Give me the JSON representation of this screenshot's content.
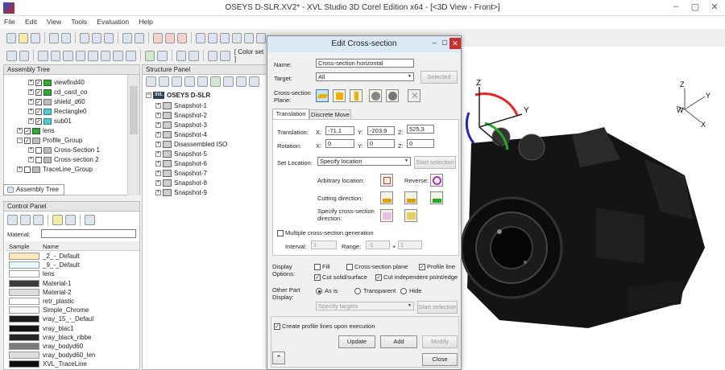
{
  "window": {
    "title": "OSEYS D-SLR.XV2* - XVL Studio 3D Corel Edition x64 - [<3D View - Front>]"
  },
  "menu": [
    "File",
    "Edit",
    "View",
    "Tools",
    "Evaluation",
    "Help"
  ],
  "toolbar2": {
    "color_set": "[ Color set ]"
  },
  "assembly_tree": {
    "header": "Assembly Tree",
    "tab": "Assembly Tree",
    "items": [
      {
        "label": "viewfind40",
        "checked": true
      },
      {
        "label": "cd_card_co",
        "checked": true
      },
      {
        "label": "shield_d60",
        "checked": true
      },
      {
        "label": "Rectangle0",
        "checked": true
      },
      {
        "label": "sub01",
        "checked": true
      },
      {
        "label": "lens",
        "checked": true
      },
      {
        "label": "Profile_Group",
        "checked": true
      },
      {
        "label": "Cross-Section 1",
        "checked": false
      },
      {
        "label": "Cross-section 2",
        "checked": false
      },
      {
        "label": "TraceLine_Group",
        "checked": false
      }
    ]
  },
  "structure_panel": {
    "header": "Structure Panel",
    "root": "OSEYS D-SLR",
    "root_icon": "XVL",
    "items": [
      "Snapshot-1",
      "Snapshot-2",
      "Snapshot-3",
      "Snapshot-4",
      "Disassembled ISO",
      "Snapshot-5",
      "Snapshot-6",
      "Snapshot-7",
      "Snapshot-8",
      "Snapshot-9"
    ]
  },
  "control_panel": {
    "header": "Control Panel",
    "material_label": "Material:",
    "col_sample": "Sample",
    "col_name": "Name",
    "materials": [
      {
        "name": "_2_-_Default",
        "color": "#fbe8b8"
      },
      {
        "name": "_9_-_Default",
        "color": "#e3f6f8"
      },
      {
        "name": "lens",
        "color": "#ffffff"
      },
      {
        "name": "Material-1",
        "color": "#3a3a3a"
      },
      {
        "name": "Material-2",
        "color": "#dcdcdc"
      },
      {
        "name": "retr_plastic",
        "color": "#ffffff"
      },
      {
        "name": "Simple_Chrome",
        "color": "#f6f6f6"
      },
      {
        "name": "vray_15_-_Defaul",
        "color": "#1c1c1c"
      },
      {
        "name": "vray_blac1",
        "color": "#151515"
      },
      {
        "name": "vray_black_ribbe",
        "color": "#262626"
      },
      {
        "name": "vray_bodyd60",
        "color": "#7a7a7a"
      },
      {
        "name": "vray_bodyd60_len",
        "color": "#dedede"
      },
      {
        "name": "XVL_TraceLine",
        "color": "#0e0e0e"
      }
    ]
  },
  "dialog": {
    "title": "Edit Cross-section",
    "name_label": "Name:",
    "name_value": "Cross-section horizontal",
    "target_label": "Target:",
    "target_value": "All",
    "selected_button": "Selected",
    "plane_label": "Cross-section Plane:",
    "tabs": [
      "Translation",
      "Discrete Move"
    ],
    "translation_label": "Translation:",
    "rotation_label": "Rotation:",
    "x_label": "X:",
    "y_label": "Y:",
    "z_label": "Z:",
    "translation": {
      "x": "-71.1",
      "y": "-203.9",
      "z": "525.3"
    },
    "rotation": {
      "x": "0",
      "y": "0",
      "z": "0"
    },
    "set_location_label": "Set Location:",
    "set_location_value": "Specify location",
    "start_selection": "Start selection",
    "arbitrary_location": "Arbitrary location:",
    "reverse": "Reverse:",
    "cutting_direction": "Cutting direction:",
    "specify_direction": "Specify cross-section direction:",
    "multiple_label": "Multiple cross-section generation",
    "interval_label": "Interval:",
    "interval_value": "1",
    "range_label": "Range:",
    "range_min": "-1",
    "range_plus": "+",
    "range_max": "1",
    "display_options_label": "Display Options:",
    "fill": "Fill",
    "cs_plane": "Cross-section plane",
    "profile_line": "Profile line",
    "cut_solid": "Cut solid/surface",
    "cut_independent": "Cut independent point/edge",
    "other_part_label": "Other Part Display:",
    "as_is": "As is",
    "transparent": "Transparent",
    "hide": "Hide",
    "specify_targets": "Specify targets",
    "start_selection2": "Start selection",
    "create_profile": "Create profile lines upon execution",
    "update": "Update",
    "add": "Add",
    "modify": "Modify",
    "close": "Close"
  },
  "viewport": {
    "axis_labels": {
      "z": "Z",
      "y": "Y",
      "w": "W",
      "x": "X"
    },
    "triad_labels": {
      "z": "Z",
      "y": "Y",
      "x": "X"
    }
  }
}
